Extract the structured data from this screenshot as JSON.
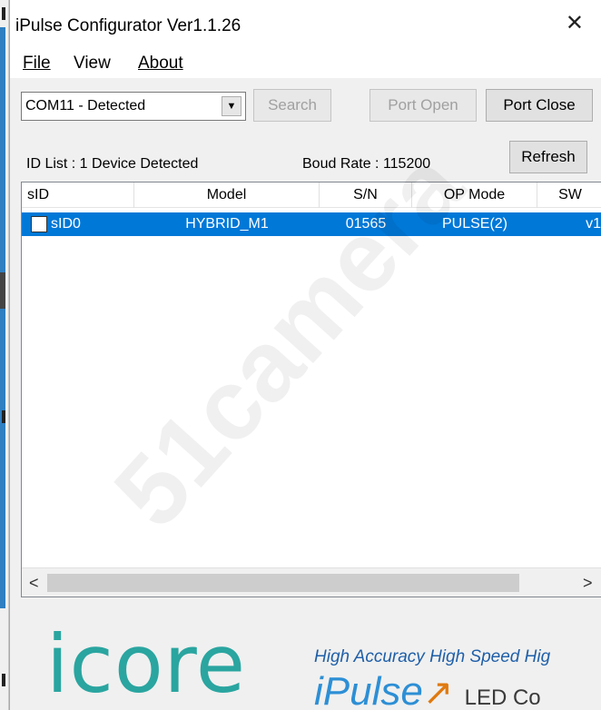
{
  "window": {
    "title": "iPulse Configurator Ver1.1.26",
    "close_glyph": "✕"
  },
  "menu": {
    "items": [
      {
        "label": "File"
      },
      {
        "label": "View"
      },
      {
        "label": "About"
      }
    ]
  },
  "toolbar": {
    "port_select_value": "COM11 - Detected",
    "search_label": "Search",
    "port_open_label": "Port Open",
    "port_close_label": "Port Close",
    "refresh_label": "Refresh"
  },
  "status": {
    "id_list": "ID List : 1 Device Detected",
    "baud_rate": "Boud Rate : 115200"
  },
  "table": {
    "columns": [
      "sID",
      "Model",
      "S/N",
      "OP Mode",
      "SW"
    ],
    "rows": [
      {
        "sid": "sID0",
        "model": "HYBRID_M1",
        "sn": "01565",
        "op_mode": "PULSE(2)",
        "sw": "v1",
        "checked": false,
        "selected": true
      }
    ]
  },
  "scrollbar": {
    "left_glyph": "<",
    "right_glyph": ">"
  },
  "branding": {
    "logo_text": "icore",
    "tagline": "High Accuracy  High Speed  Hig",
    "product": "iPulse",
    "product_suffix": "LED Co",
    "accent_color": "#2d8fd5",
    "selection_color": "#0078d7"
  },
  "watermark": "51camera"
}
